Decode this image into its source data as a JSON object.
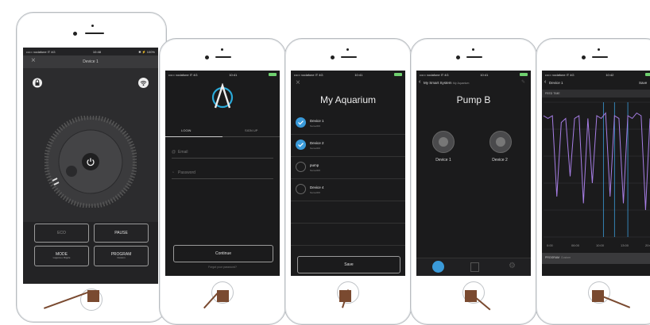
{
  "phone1": {
    "carrier": "••••○ vodafone IT  4G",
    "time": "10:48",
    "battery": "✱ ⚡ 100%",
    "title": "Device 1",
    "buttons": [
      {
        "label": "ECO",
        "sub": ""
      },
      {
        "label": "PAUSE",
        "sub": ""
      },
      {
        "label": "MODE",
        "sub": "Laguna e Ripple"
      },
      {
        "label": "PROGRAM",
        "sub": "Custom"
      }
    ]
  },
  "phone2": {
    "carrier": "••••○ vodafone IT  4G",
    "time": "10:41",
    "battery": "✱ ⚡ 100%",
    "tabs": [
      "LOGIN",
      "SIGN UP"
    ],
    "email_placeholder": "Email",
    "password_placeholder": "Password",
    "continue_label": "Continue",
    "forgot_label": "Forgot your password?"
  },
  "phone3": {
    "carrier": "••••○ vodafone IT  4G",
    "time": "10:41",
    "battery": "✱ ⚡ 100%",
    "title": "My Aquarium",
    "devices": [
      {
        "name": "Device 1",
        "sub": "Name000",
        "checked": true
      },
      {
        "name": "Device 2",
        "sub": "Name000",
        "checked": true
      },
      {
        "name": "pump",
        "sub": "Name000",
        "checked": false
      },
      {
        "name": "Device 4",
        "sub": "Name000",
        "checked": false
      }
    ],
    "save_label": "Save"
  },
  "phone4": {
    "carrier": "••••○ vodafone IT  4G",
    "time": "10:41",
    "battery": "✱ ⚡ 100%",
    "back_label": "My Smart System",
    "subtitle": "My Aquarium",
    "title": "Pump B",
    "pumps": [
      "Device 1",
      "Device 2"
    ]
  },
  "phone5": {
    "carrier": "••••○ vodafone IT  4G",
    "time": "10:42",
    "battery": "✱ ⚡ 100%",
    "back_label": "Device 1",
    "save_label": "Save",
    "section": "FEED TIME",
    "x_ticks": [
      "0:00",
      "06:00",
      "10:00",
      "13:00",
      "20:00"
    ],
    "program_label": "PROGRAM",
    "program_value": "Custom"
  },
  "chart_data": {
    "type": "line",
    "title": "FEED TIME",
    "x_ticks": [
      "0:00",
      "06:00",
      "10:00",
      "13:00",
      "20:00"
    ],
    "x": [
      0,
      1,
      2,
      3,
      4,
      5,
      6,
      7,
      8,
      9,
      10,
      11,
      12,
      13,
      14,
      15,
      16,
      17,
      18,
      19,
      20,
      21,
      22,
      23,
      24
    ],
    "series": [
      {
        "values": [
          90,
          88,
          90,
          30,
          85,
          88,
          45,
          88,
          90,
          25,
          88,
          40,
          90,
          88,
          92,
          30,
          90,
          88,
          25,
          90,
          88,
          92,
          90,
          20,
          88
        ]
      }
    ],
    "ylim": [
      0,
      100
    ],
    "markers_x": [
      13.5,
      16,
      19
    ],
    "colors": {
      "line": "#a77ee6",
      "marker": "#3a9ad9"
    }
  }
}
